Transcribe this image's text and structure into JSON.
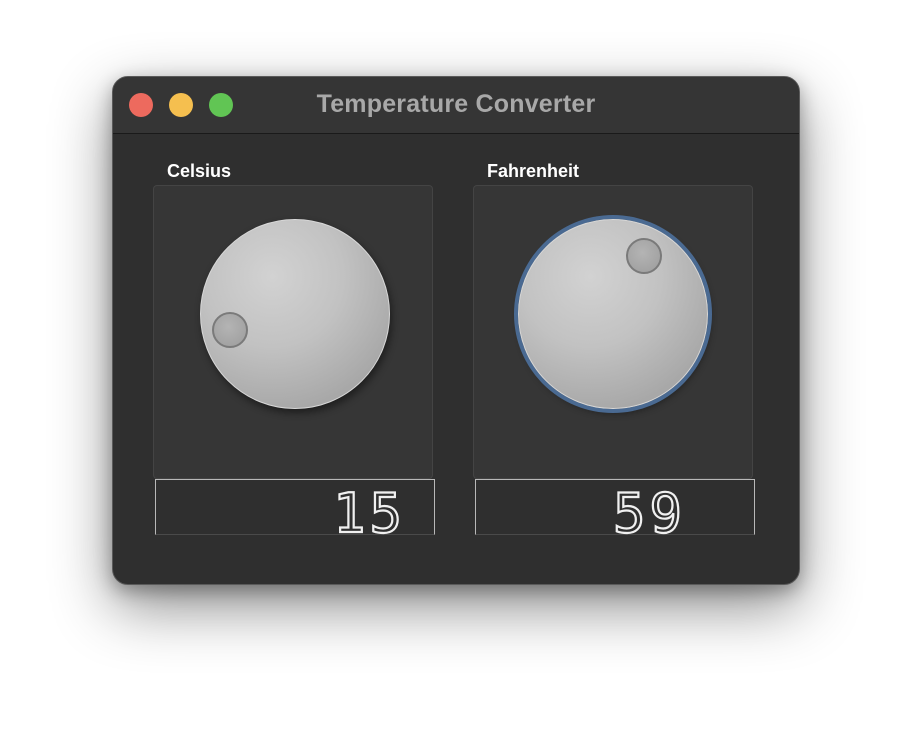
{
  "window": {
    "title": "Temperature Converter"
  },
  "celsius": {
    "label": "Celsius",
    "value": "15"
  },
  "fahrenheit": {
    "label": "Fahrenheit",
    "value": "59"
  },
  "colors": {
    "close": "#ed6a5e",
    "minimize": "#f5bf4f",
    "zoom": "#61c554",
    "focus_ring": "#4a6a92"
  }
}
